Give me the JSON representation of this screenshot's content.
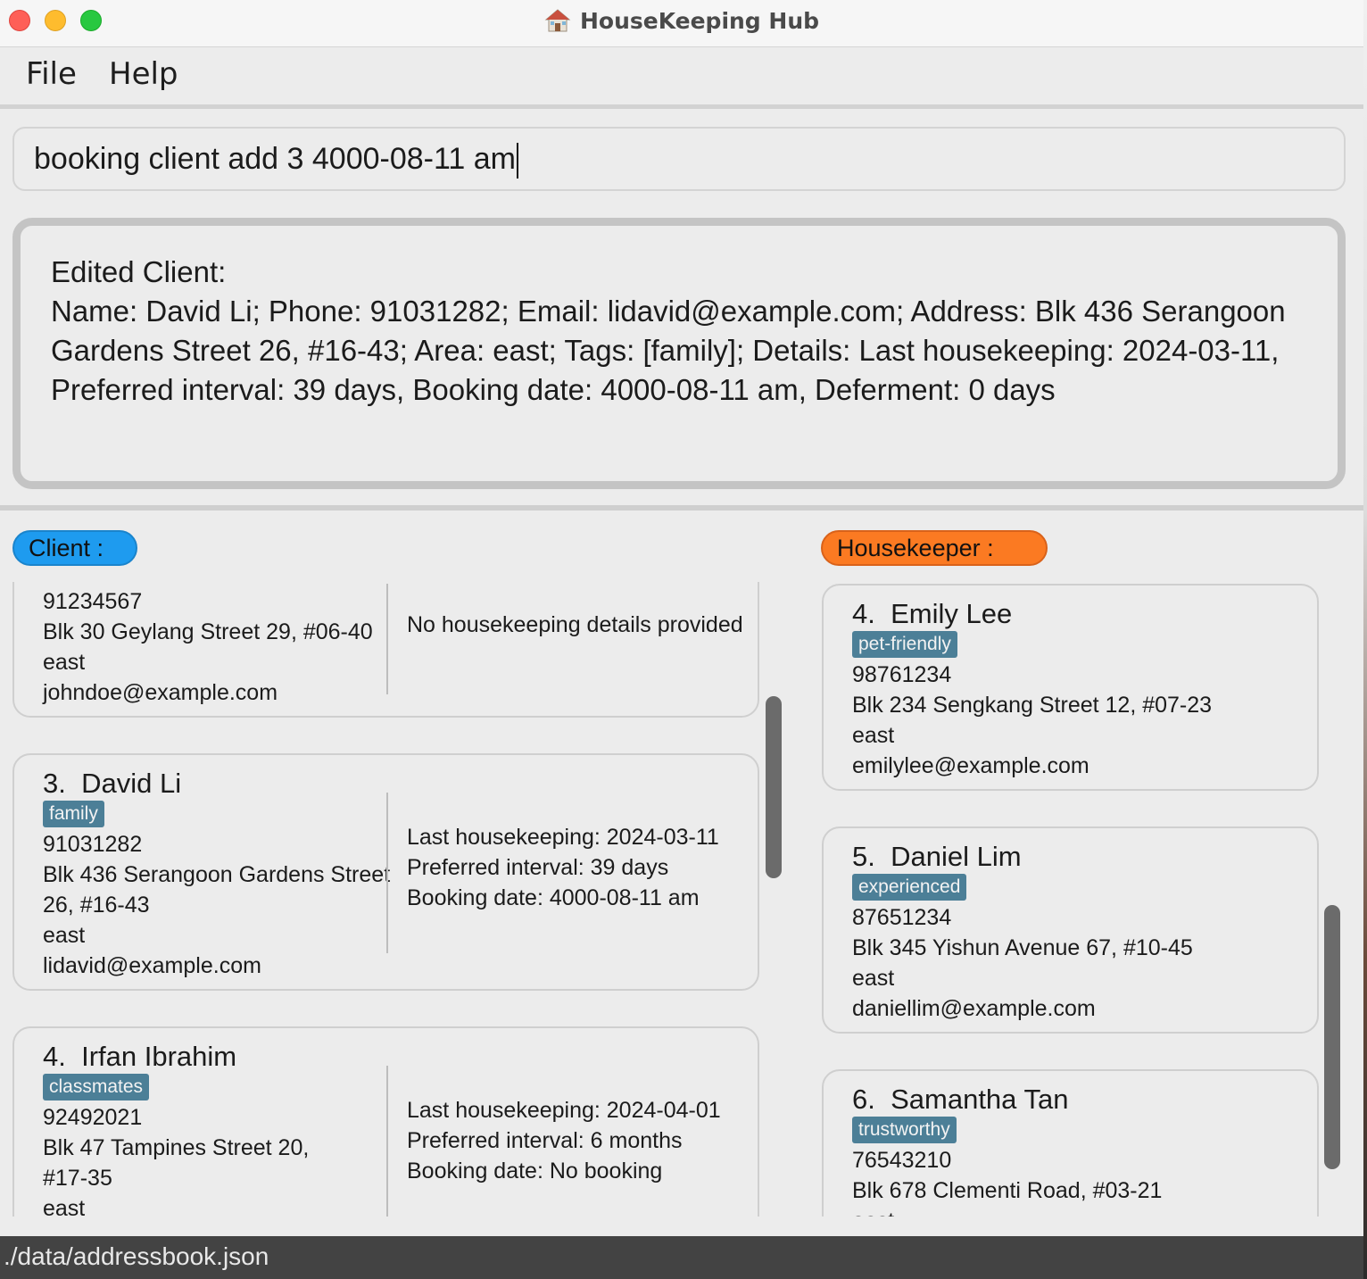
{
  "window": {
    "title": "HouseKeeping Hub",
    "app_icon": "house-icon"
  },
  "menu": {
    "file": "File",
    "help": "Help"
  },
  "command": {
    "value": "booking client add 3 4000-08-11 am"
  },
  "result": {
    "text": "Edited Client:\nName: David Li; Phone: 91031282; Email: lidavid@example.com; Address: Blk 436 Serangoon\nGardens Street 26, #16-43; Area: east; Tags: [family]; Details: Last housekeeping: 2024-03-11,\nPreferred interval: 39 days, Booking date: 4000-08-11 am, Deferment: 0 days"
  },
  "client_list": {
    "header": "Client :",
    "cards": [
      {
        "phone": "91234567",
        "address": "Blk 30 Geylang Street 29, #06-40",
        "area": "east",
        "email": "johndoe@example.com",
        "details": "No housekeeping details provided"
      },
      {
        "index": "3.",
        "name": "David Li",
        "tag": "family",
        "phone": "91031282",
        "address_line1": "Blk 436 Serangoon Gardens Street",
        "address_line2": "26, #16-43",
        "area": "east",
        "email": "lidavid@example.com",
        "last_housekeeping": "Last housekeeping: 2024-03-11",
        "preferred_interval": "Preferred interval: 39 days",
        "booking_date": "Booking date: 4000-08-11 am"
      },
      {
        "index": "4.",
        "name": "Irfan Ibrahim",
        "tag": "classmates",
        "phone": "92492021",
        "address_line1": "Blk 47 Tampines Street 20,",
        "address_line2": "#17-35",
        "area": "east",
        "last_housekeeping": "Last housekeeping: 2024-04-01",
        "preferred_interval": "Preferred interval: 6 months",
        "booking_date": "Booking date: No booking"
      }
    ]
  },
  "housekeeper_list": {
    "header": "Housekeeper :",
    "cards": [
      {
        "index": "4.",
        "name": "Emily Lee",
        "tag": "pet-friendly",
        "phone": "98761234",
        "address": "Blk 234 Sengkang Street 12, #07-23",
        "area": "east",
        "email": "emilylee@example.com"
      },
      {
        "index": "5.",
        "name": "Daniel Lim",
        "tag": "experienced",
        "phone": "87651234",
        "address": "Blk 345 Yishun Avenue 67, #10-45",
        "area": "east",
        "email": "daniellim@example.com"
      },
      {
        "index": "6.",
        "name": "Samantha Tan",
        "tag": "trustworthy",
        "phone": "76543210",
        "address": "Blk 678 Clementi Road, #03-21",
        "area": "east"
      }
    ]
  },
  "status": {
    "path": "./data/addressbook.json"
  },
  "colors": {
    "client_header": "#1e9bef",
    "housekeeper_header": "#fb7a22",
    "tag_bg": "#4c7f97",
    "status_bar": "#434343"
  }
}
